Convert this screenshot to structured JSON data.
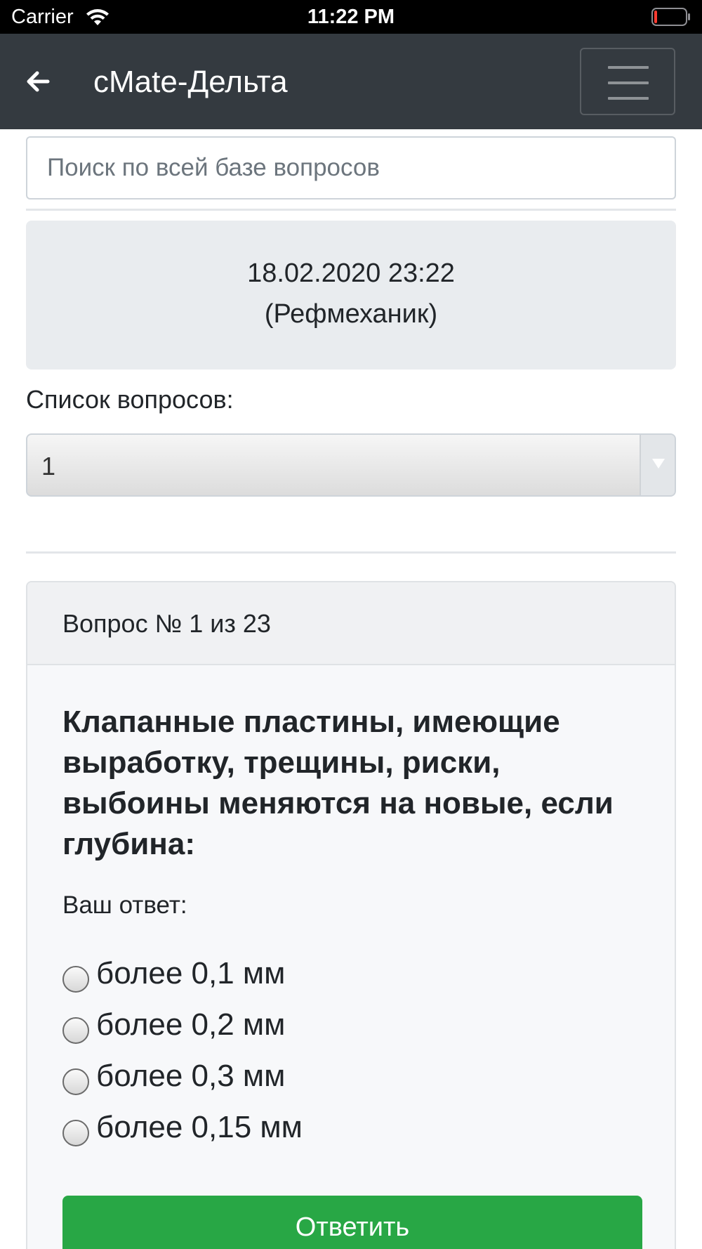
{
  "status_bar": {
    "carrier": "Carrier",
    "time": "11:22 PM",
    "battery_color": "#ff3b30"
  },
  "navbar": {
    "title": "cMate-Дельта",
    "back_icon": "arrow-left-icon",
    "menu_icon": "hamburger-icon"
  },
  "search": {
    "placeholder": "Поиск по всей базе вопросов",
    "value": ""
  },
  "info": {
    "datetime": "18.02.2020 23:22",
    "role": "(Рефмеханик)"
  },
  "question_list": {
    "label": "Список вопросов:",
    "selected": "1"
  },
  "question": {
    "number_label": "Вопрос № 1 из 23",
    "text": "Клапанные пластины, имеющие выработку, трещины, риски, выбоины меняются на новые, если глубина:",
    "answer_label": "Ваш ответ:",
    "options": [
      {
        "label": "более 0,1 мм",
        "checked": false
      },
      {
        "label": "более 0,2 мм",
        "checked": false
      },
      {
        "label": "более 0,3 мм",
        "checked": false
      },
      {
        "label": "более 0,15 мм",
        "checked": false
      }
    ],
    "submit_label": "Ответить"
  },
  "colors": {
    "navbar": "#343a40",
    "submit": "#28a745",
    "info_card": "#e9ecef"
  }
}
